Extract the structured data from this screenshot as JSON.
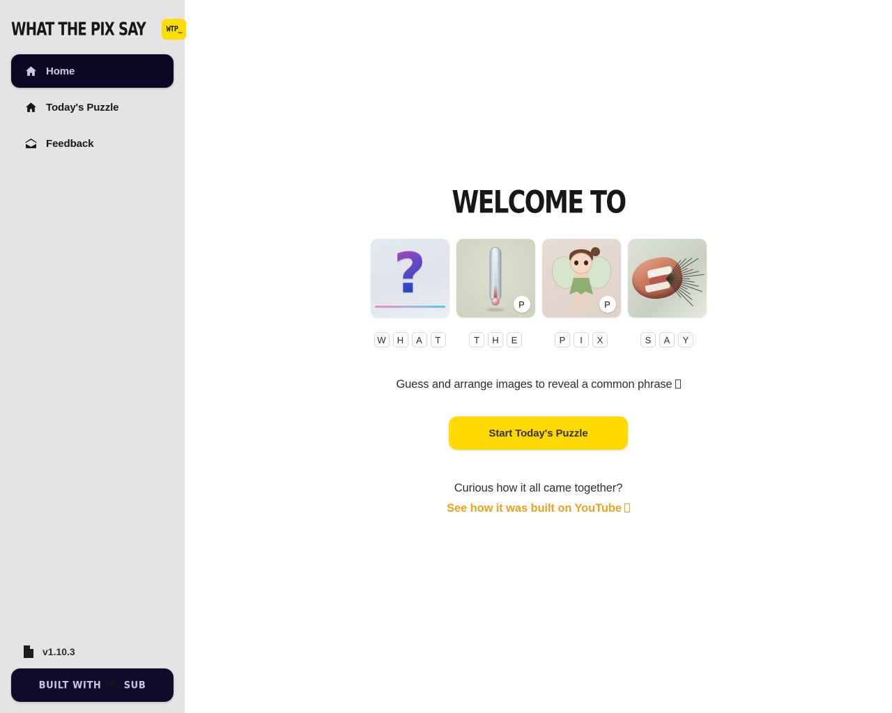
{
  "sidebar": {
    "brand": {
      "title": "WHAT THE PIX SAY",
      "badge": "WTP_"
    },
    "nav": [
      {
        "label": "Home",
        "icon": "home-icon",
        "active": true
      },
      {
        "label": "Today's Puzzle",
        "icon": "home-icon",
        "active": false
      },
      {
        "label": "Feedback",
        "icon": "envelope-icon",
        "active": false
      }
    ],
    "footer": {
      "version": "v1.10.3",
      "version_icon": "file-icon",
      "built_with_prefix": "BUILT WITH",
      "built_with_emoji": "🛥",
      "built_with_suffix": "SUB"
    }
  },
  "main": {
    "heading": "WELCOME TO",
    "puzzle": {
      "words": [
        {
          "letters": [
            "W",
            "H",
            "A",
            "T"
          ],
          "image": {
            "art": "art-question",
            "alt": "question-mark-image",
            "badge": null
          }
        },
        {
          "letters": [
            "T",
            "H",
            "E"
          ],
          "image": {
            "art": "art-thermo",
            "alt": "thermometer-image",
            "badge": "P"
          }
        },
        {
          "letters": [
            "P",
            "I",
            "X"
          ],
          "image": {
            "art": "art-fairy",
            "alt": "fairy-pixie-image",
            "badge": "P"
          }
        },
        {
          "letters": [
            "S",
            "A",
            "Y"
          ],
          "image": {
            "art": "art-mouth",
            "alt": "speaking-mouth-image",
            "badge": null
          }
        }
      ]
    },
    "tagline": "Guess and arrange images to reveal a common phrase",
    "cta_label": "Start Today's Puzzle",
    "curious_text": "Curious how it all came together?",
    "youtube_link": "See how it was built on YouTube"
  },
  "colors": {
    "accent_yellow": "#ffd900",
    "sidebar_bg": "#e4e4e4",
    "nav_active_bg": "#0d0524",
    "nav_active_text": "#cfc8e8",
    "link_amber": "#eba41c",
    "badge_navy": "#110b2b"
  }
}
